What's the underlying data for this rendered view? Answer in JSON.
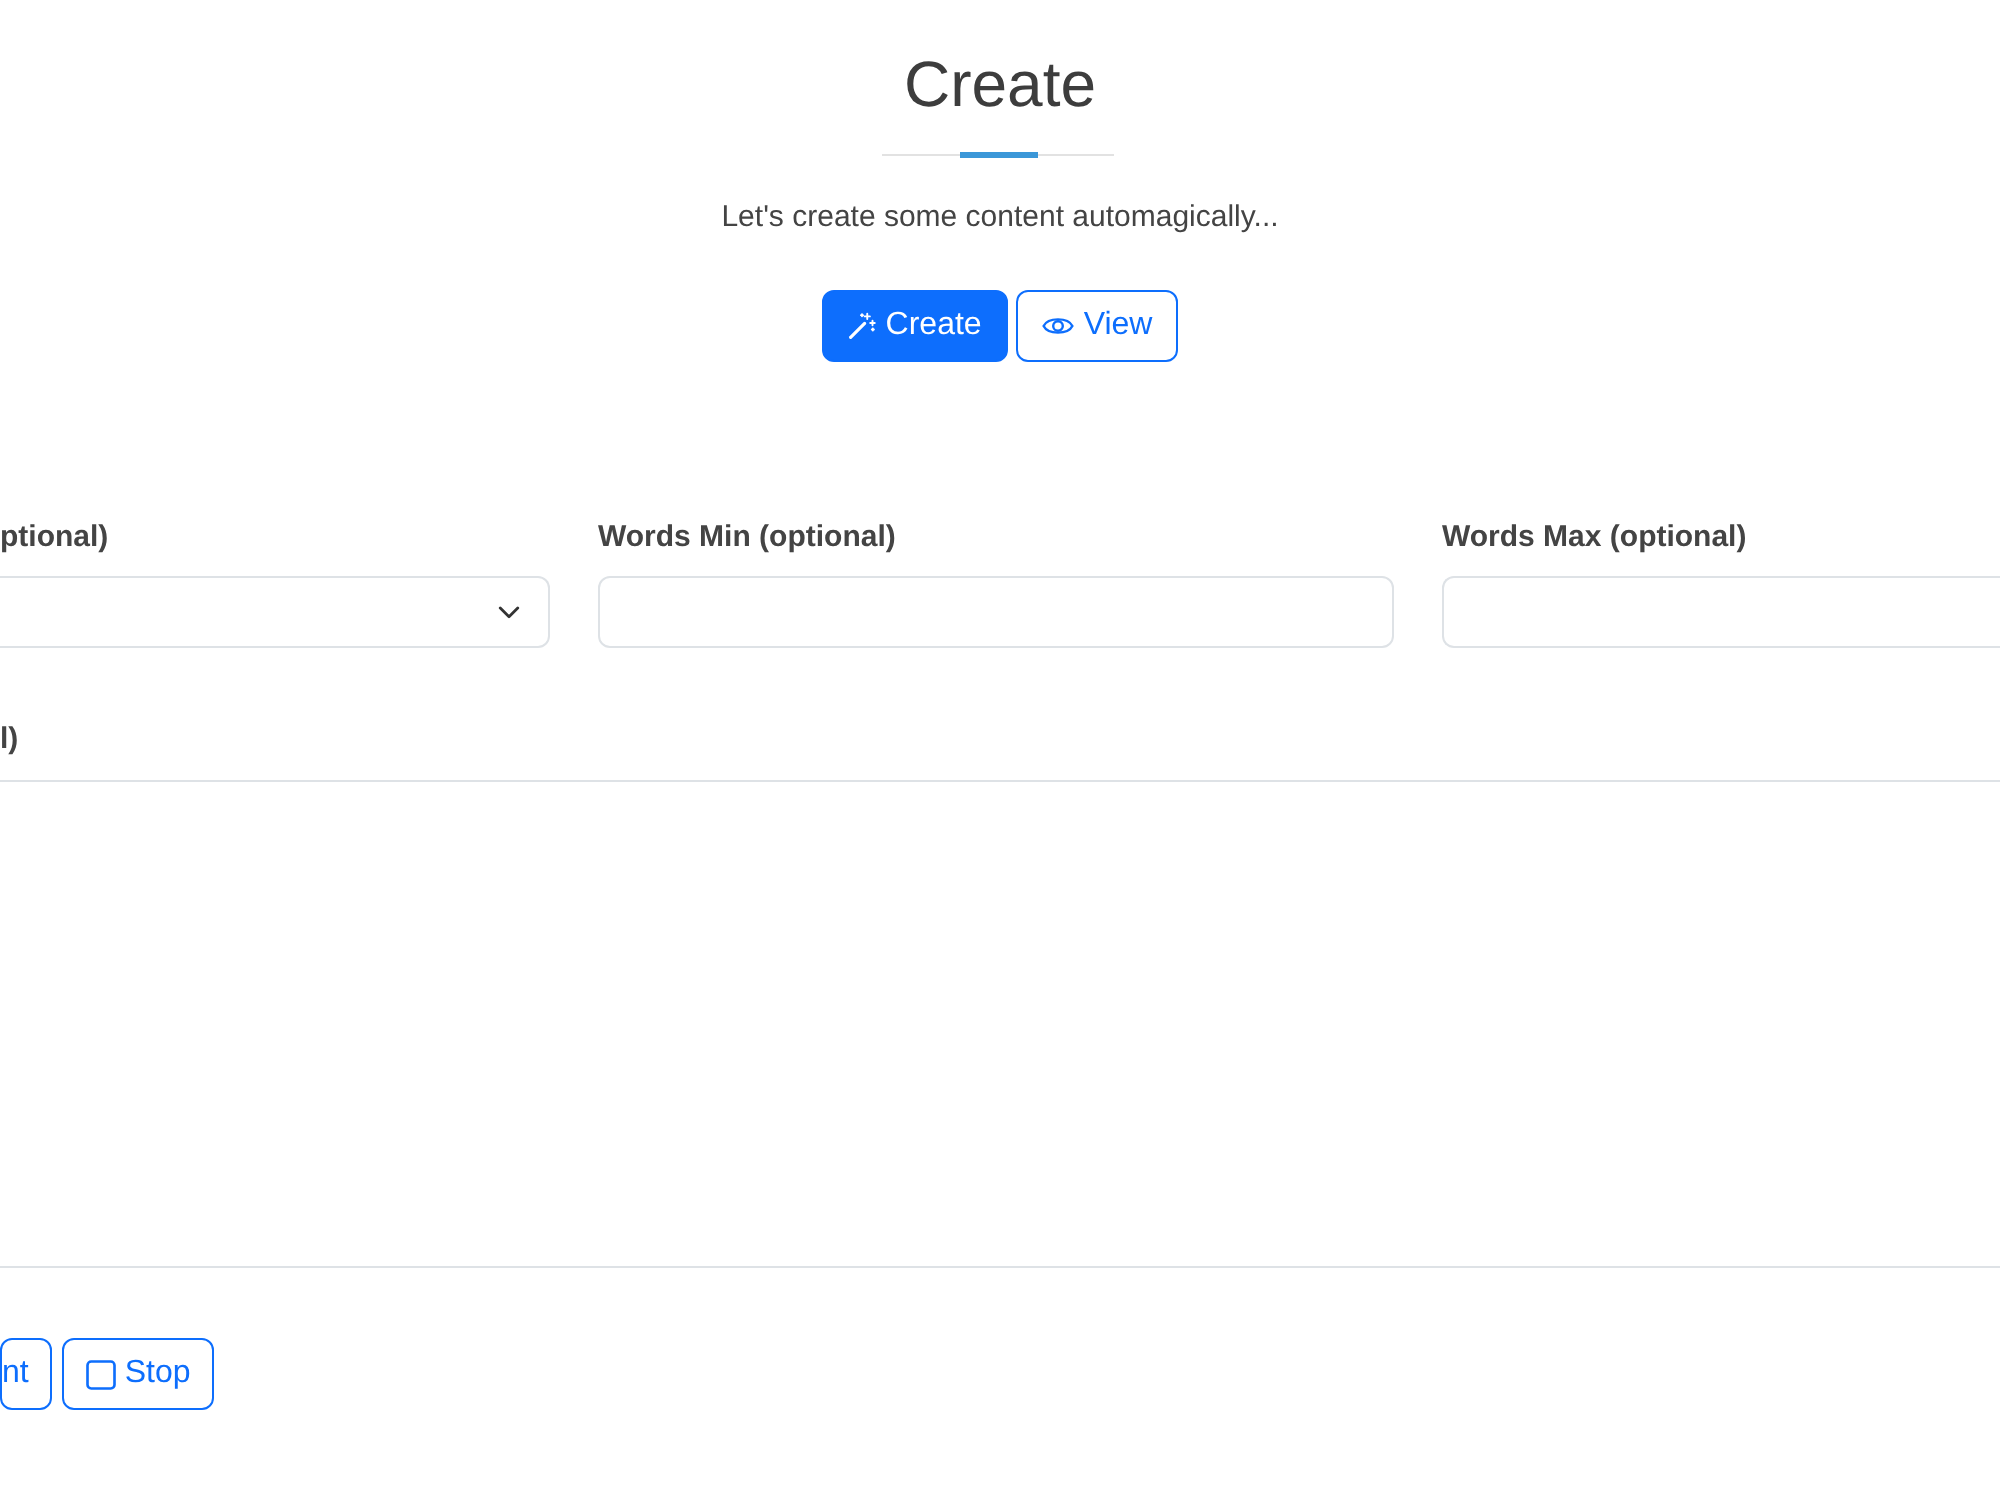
{
  "header": {
    "title": "Create",
    "subtitle": "Let's create some content automagically..."
  },
  "tabs": [
    {
      "label": "Create",
      "selected": true
    },
    {
      "label": "View",
      "selected": false
    }
  ],
  "form": {
    "fields": [
      {
        "label": "ptional)",
        "kind": "select"
      },
      {
        "label": "Words Min (optional)",
        "kind": "input"
      },
      {
        "label": "Words Max (optional)",
        "kind": "input"
      }
    ],
    "text_area": {
      "label": "l)"
    },
    "buttons": [
      {
        "label": "nt"
      },
      {
        "label": "Stop"
      }
    ]
  }
}
